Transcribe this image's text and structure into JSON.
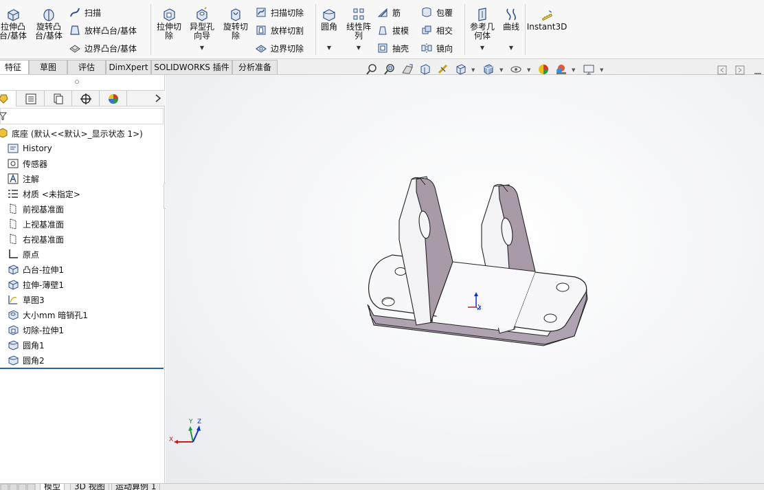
{
  "ribbon": {
    "extrude_boss": "拉伸凸\n台/基体",
    "revolve_boss": "旋转凸\n台/基体",
    "sweep": "扫描",
    "loft_boss": "放样凸台/基体",
    "boundary_boss": "边界凸台/基体",
    "extrude_cut": "拉伸切\n除",
    "hole_wizard": "异型孔\n向导",
    "revolve_cut": "旋转切\n除",
    "sweep_cut": "扫描切除",
    "loft_cut": "放样切割",
    "boundary_cut": "边界切除",
    "fillet": "圆角",
    "linear_pattern": "线性阵\n列",
    "rib": "筋",
    "draft": "拔模",
    "shell": "抽壳",
    "wrap": "包覆",
    "intersect": "相交",
    "mirror": "镜向",
    "ref_geometry": "参考几\n何体",
    "curves": "曲线",
    "instant3d": "Instant3D"
  },
  "tabs": [
    "特征",
    "草图",
    "评估",
    "DimXpert",
    "SOLIDWORKS 插件",
    "分析准备"
  ],
  "tree": {
    "root": "底座 (默认<<默认>_显示状态 1>)",
    "items": [
      "History",
      "传感器",
      "注解",
      "材质 <未指定>",
      "前视基准面",
      "上视基准面",
      "右视基准面",
      "原点",
      "凸台-拉伸1",
      "拉伸-薄壁1",
      "草图3",
      "大小mm 暗销孔1",
      "切除-拉伸1",
      "圆角1",
      "圆角2"
    ]
  },
  "triad": {
    "x": "X",
    "y": "Y",
    "z": "Z"
  },
  "bottom_tabs": [
    "模型",
    "3D 视图",
    "运动算例 1"
  ],
  "colors": {
    "accent": "#2f5fb0",
    "part_face": "#a99aa8",
    "part_light": "#f6f6f8"
  }
}
